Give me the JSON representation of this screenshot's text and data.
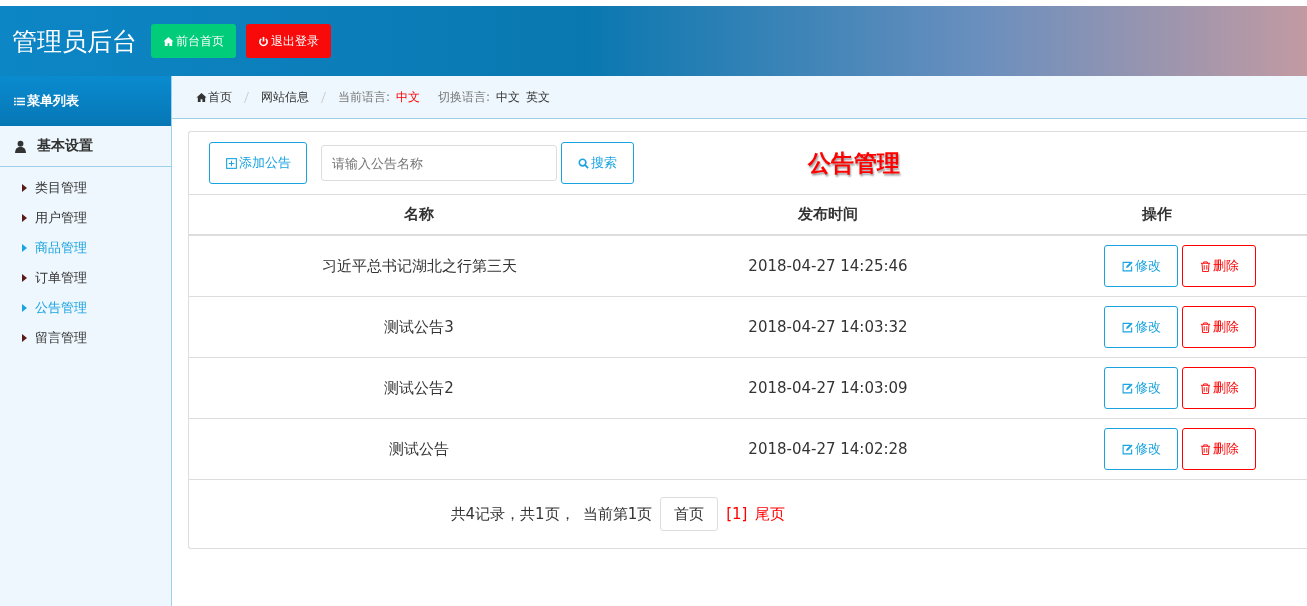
{
  "header": {
    "title": "管理员后台",
    "buttons": [
      {
        "kind": "home",
        "label": "前台首页"
      },
      {
        "kind": "logout",
        "label": "退出登录"
      }
    ]
  },
  "sidebar": {
    "title": "菜单列表",
    "group": {
      "label": "基本设置",
      "items": [
        {
          "label": "类目管理",
          "active": false
        },
        {
          "label": "用户管理",
          "active": false
        },
        {
          "label": "商品管理",
          "active": true
        },
        {
          "label": "订单管理",
          "active": false
        },
        {
          "label": "公告管理",
          "active": true
        },
        {
          "label": "留言管理",
          "active": false
        }
      ]
    }
  },
  "breadcrumb": {
    "home": "首页",
    "site": "网站信息",
    "current_language_label": "当前语言:",
    "current_language": "中文",
    "switch_label": "切换语言:",
    "languages": [
      "中文",
      "英文"
    ]
  },
  "toolbar": {
    "add_button": "添加公告",
    "search": {
      "placeholder": "请输入公告名称"
    },
    "search_button": "搜索",
    "heading": "公告管理"
  },
  "table": {
    "columns": [
      "名称",
      "发布时间",
      "操作"
    ],
    "rows": [
      {
        "name": "习近平总书记湖北之行第三天",
        "time": "2018-04-27 14:25:46",
        "edit": "修改",
        "delete": "删除"
      },
      {
        "name": "测试公告3",
        "time": "2018-04-27 14:03:32",
        "edit": "修改",
        "delete": "删除"
      },
      {
        "name": "测试公告2",
        "time": "2018-04-27 14:03:09",
        "edit": "修改",
        "delete": "删除"
      },
      {
        "name": "测试公告",
        "time": "2018-04-27 14:02:28",
        "edit": "修改",
        "delete": "删除"
      }
    ]
  },
  "pagination": {
    "summary": "共4记录，共1页，",
    "current": "当前第1页",
    "first": "首页",
    "page": "[1]",
    "last": "尾页"
  }
}
